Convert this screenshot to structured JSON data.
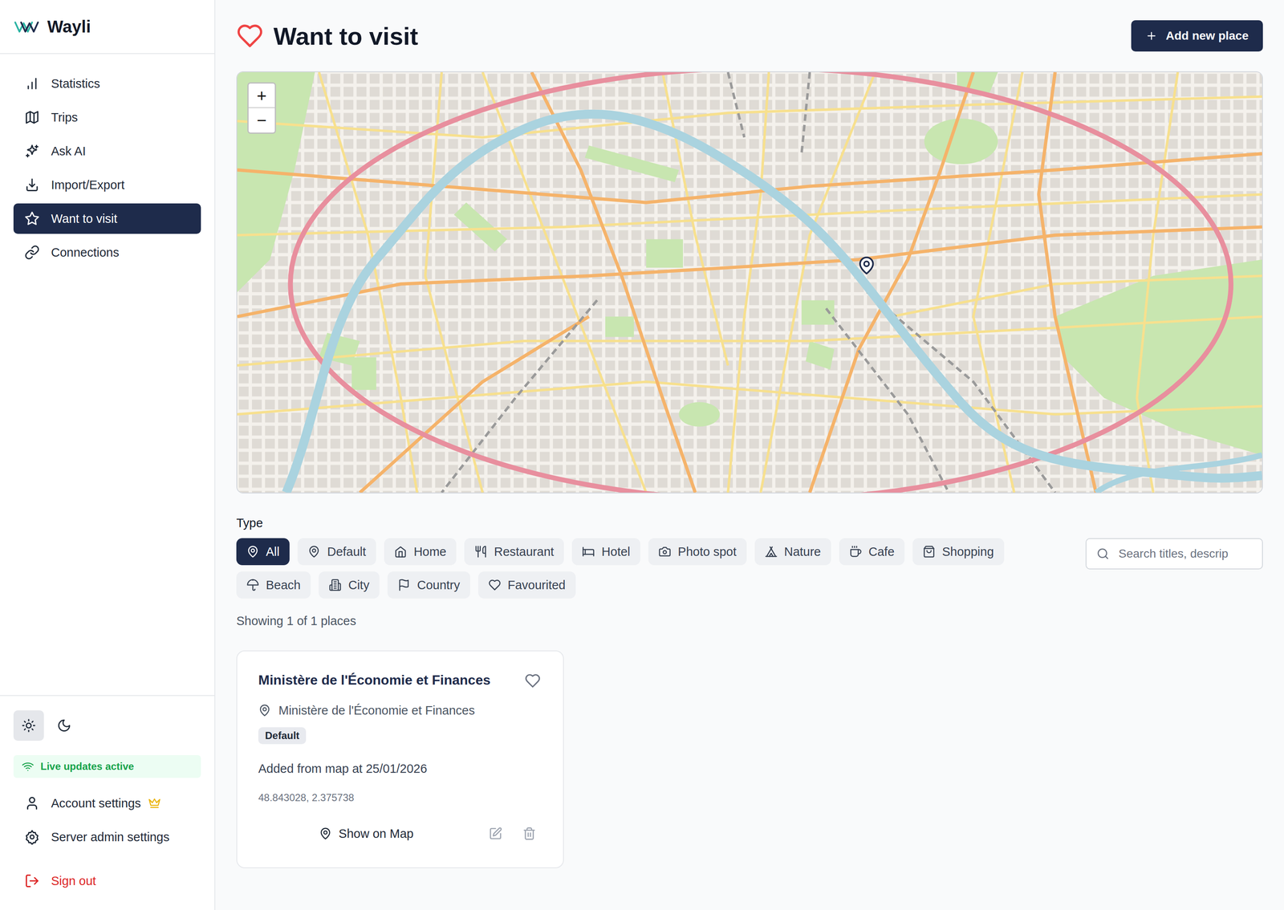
{
  "app": {
    "name": "Wayli"
  },
  "sidebar": {
    "items": [
      {
        "label": "Statistics",
        "selected": false
      },
      {
        "label": "Trips",
        "selected": false
      },
      {
        "label": "Ask AI",
        "selected": false
      },
      {
        "label": "Import/Export",
        "selected": false
      },
      {
        "label": "Want to visit",
        "selected": true
      },
      {
        "label": "Connections",
        "selected": false
      }
    ],
    "theme": [
      {
        "kind": "light",
        "selected": true
      },
      {
        "kind": "dark",
        "selected": false
      }
    ],
    "status": {
      "label": "Live updates active",
      "on": true
    },
    "footer_items": [
      {
        "label": "Account settings",
        "kind": "account",
        "premium": true
      },
      {
        "label": "Server admin settings",
        "kind": "admin",
        "premium": false
      },
      {
        "label": "Sign out",
        "kind": "signout",
        "premium": false
      }
    ]
  },
  "page": {
    "title": "Want to visit",
    "add_button": "Add new place"
  },
  "map": {
    "zoom_in": "+",
    "zoom_out": "−"
  },
  "filters": {
    "label": "Type",
    "items": [
      {
        "label": "All",
        "selected": true
      },
      {
        "label": "Default",
        "selected": false
      },
      {
        "label": "Home",
        "selected": false
      },
      {
        "label": "Restaurant",
        "selected": false
      },
      {
        "label": "Hotel",
        "selected": false
      },
      {
        "label": "Photo spot",
        "selected": false
      },
      {
        "label": "Nature",
        "selected": false
      },
      {
        "label": "Cafe",
        "selected": false
      },
      {
        "label": "Shopping",
        "selected": false
      },
      {
        "label": "Beach",
        "selected": false
      },
      {
        "label": "City",
        "selected": false
      },
      {
        "label": "Country",
        "selected": false
      },
      {
        "label": "Favourited",
        "selected": false
      }
    ]
  },
  "search": {
    "placeholder": "Search titles, descrip"
  },
  "summary": "Showing 1 of 1 places",
  "places": [
    {
      "title": "Ministère de l'Économie et Finances",
      "location": "Ministère de l'Économie et Finances",
      "type": "Default",
      "favourite": false,
      "description": "Added from map at 25/01/2026",
      "coordinates": "48.843028, 2.375738",
      "action": "Show on Map"
    }
  ]
}
